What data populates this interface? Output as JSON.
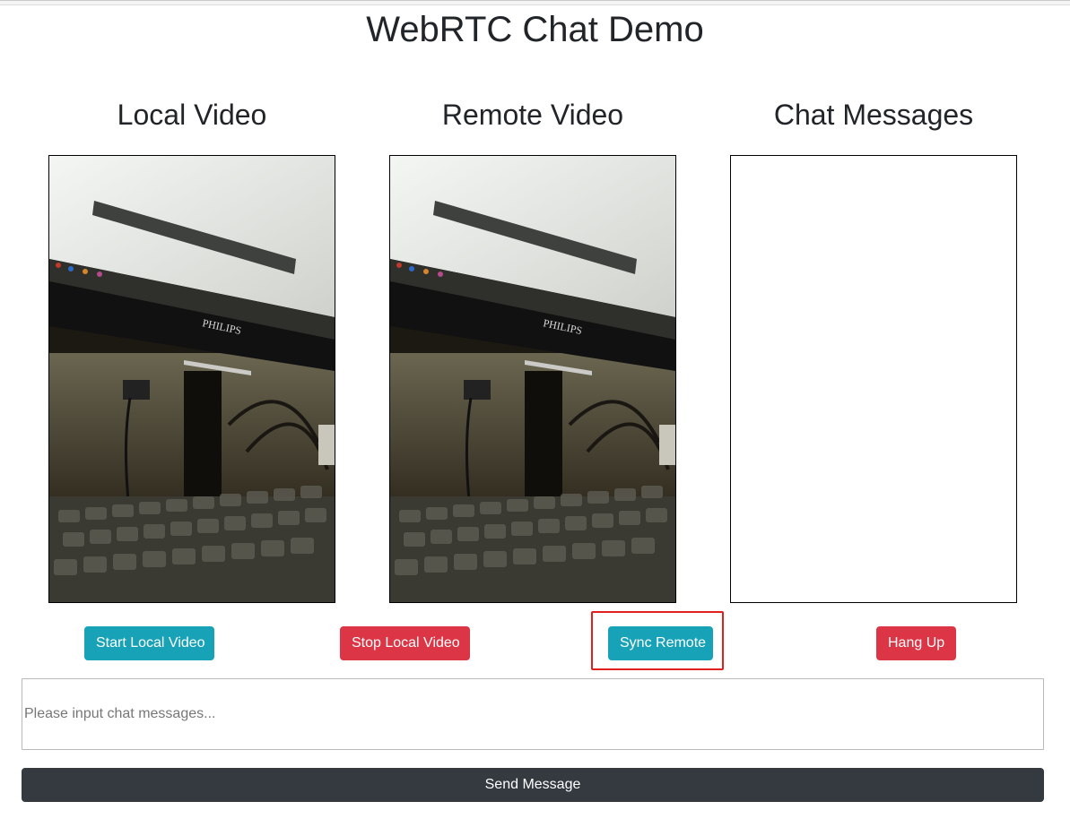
{
  "header": {
    "title": "WebRTC Chat Demo"
  },
  "columns": {
    "local_title": "Local Video",
    "remote_title": "Remote Video",
    "chat_title": "Chat Messages"
  },
  "video_brand_text": "PHILIPS",
  "chat": {
    "messages": []
  },
  "buttons": {
    "start_local": "Start Local Video",
    "stop_local": "Stop Local Video",
    "sync_remote": "Sync Remote",
    "hang_up": "Hang Up",
    "send_message": "Send Message"
  },
  "input": {
    "placeholder": "Please input chat messages...",
    "value": ""
  },
  "colors": {
    "info": "#17a2b8",
    "danger": "#dc3545",
    "dark": "#343a40",
    "highlight": "#e0201c"
  }
}
